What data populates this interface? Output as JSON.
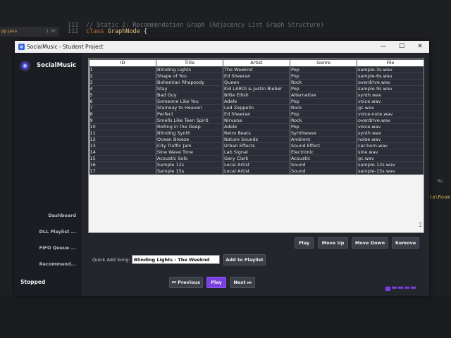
{
  "ide": {
    "tab_file": "pp.java",
    "tab_pos": "1, M",
    "code_lines": [
      {
        "num": "111",
        "text": "// Static 2: Recommendation Graph (Adjacency List Graph Structure)"
      },
      {
        "num": "112",
        "kw": "class",
        "name": "GraphNode",
        "rest": " {"
      }
    ],
    "right_label": "Ru",
    "right_text": "ta\\Roam"
  },
  "window": {
    "title": "SocialMusic - Student Project",
    "controls": {
      "minimize": "—",
      "maximize": "☐",
      "close": "✕"
    }
  },
  "sidebar": {
    "brand": "SocialMusic",
    "nav": [
      "Dashboard",
      "DLL Playlist ...",
      "FIFO Queue ...",
      "Recommend..."
    ],
    "status": "Stopped"
  },
  "table": {
    "columns": [
      "ID",
      "Title",
      "Artist",
      "Genre",
      "File"
    ],
    "rows": [
      [
        "1",
        "Blinding Lights",
        "The Weeknd",
        "Pop",
        "sample-3s.wav"
      ],
      [
        "2",
        "Shape of You",
        "Ed Sheeran",
        "Pop",
        "sample-6s.wav"
      ],
      [
        "3",
        "Bohemian Rhapsody",
        "Queen",
        "Rock",
        "overdrive.wav"
      ],
      [
        "4",
        "Stay",
        "Kid LAROI & Justin Bieber",
        "Pop",
        "sample-9s.wav"
      ],
      [
        "5",
        "Bad Guy",
        "Billie Eilish",
        "Alternative",
        "synth.wav"
      ],
      [
        "6",
        "Someone Like You",
        "Adele",
        "Pop",
        "voice.wav"
      ],
      [
        "7",
        "Stairway to Heaven",
        "Led Zeppelin",
        "Rock",
        "gc.wav"
      ],
      [
        "8",
        "Perfect",
        "Ed Sheeran",
        "Pop",
        "voice-note.wav"
      ],
      [
        "9",
        "Smells Like Teen Spirit",
        "Nirvana",
        "Rock",
        "overdrive.wav"
      ],
      [
        "10",
        "Rolling in the Deep",
        "Adele",
        "Pop",
        "voice.wav"
      ],
      [
        "11",
        "Blinding Synth",
        "Retro Beats",
        "Synthwave",
        "synth.wav"
      ],
      [
        "12",
        "Ocean Breeze",
        "Nature Sounds",
        "Ambient",
        "noise.wav"
      ],
      [
        "13",
        "City Traffic Jam",
        "Urban Effects",
        "Sound Effect",
        "car-horn.wav"
      ],
      [
        "14",
        "Sine Wave Tone",
        "Lab Signal",
        "Electronic",
        "sine.wav"
      ],
      [
        "15",
        "Acoustic Solo",
        "Gary Clark",
        "Acoustic",
        "gc.wav"
      ],
      [
        "16",
        "Sample 12s",
        "Local Artist",
        "Sound",
        "sample-12s.wav"
      ],
      [
        "17",
        "Sample 15s",
        "Local Artist",
        "Sound",
        "sample-15s.wav"
      ]
    ]
  },
  "actions": {
    "play": "Play",
    "move_up": "Move Up",
    "move_down": "Move Down",
    "remove": "Remove"
  },
  "quick_add": {
    "label": "Quick Add Song:",
    "value": "Blinding Lights - The Weeknd",
    "button": "Add to Playlist"
  },
  "player": {
    "previous": "⏮ Previous",
    "play": "Play",
    "next": "Next ⏭"
  },
  "colors": {
    "accent": "#7a3fe0",
    "sidebar_bg": "#1b1d22",
    "window_bg": "#23262d",
    "row_bg": "#2b2e36"
  }
}
